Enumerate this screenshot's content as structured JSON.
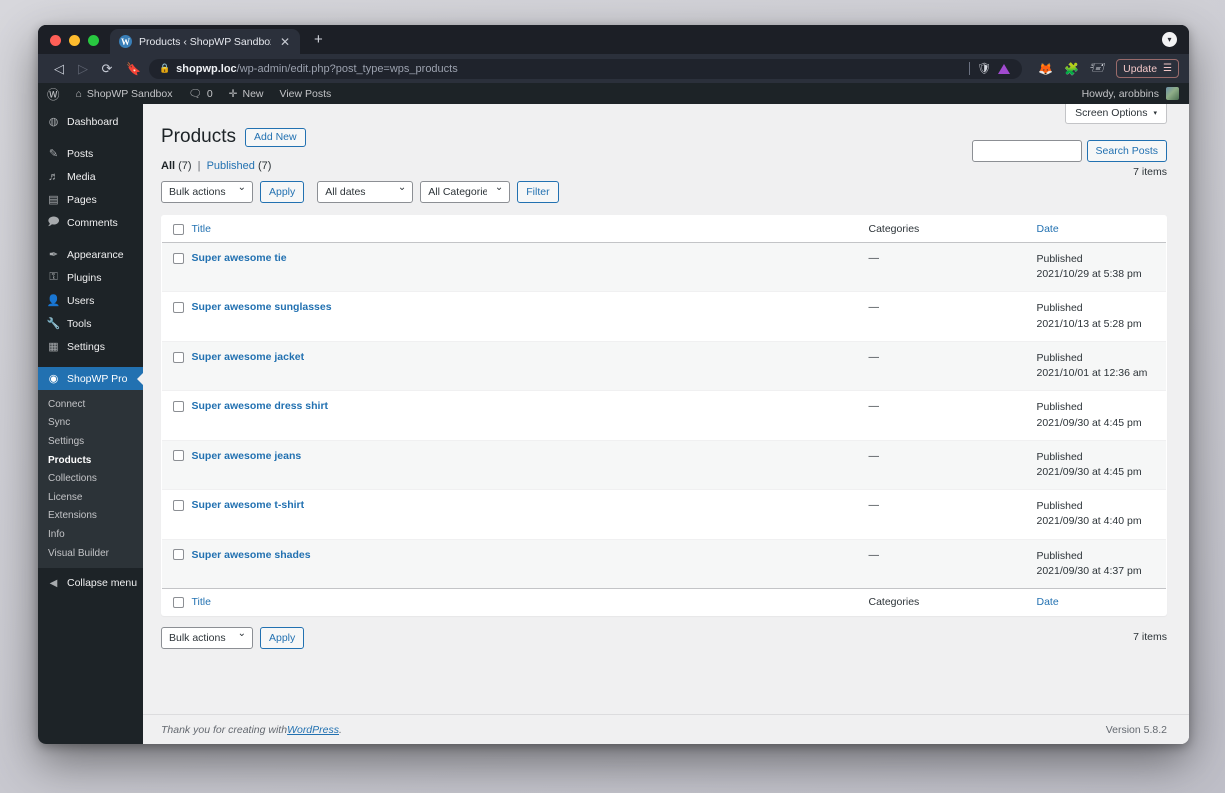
{
  "browser": {
    "tab": {
      "title": "Products ‹ ShopWP Sandbox —",
      "favicon": "wordpress-icon",
      "close": "✕"
    },
    "new_tab": "+",
    "window_menu_icon": "chevron-down-circle-icon",
    "nav": {
      "back": "◁",
      "forward": "▷",
      "reload": "⟳",
      "bookmark": "bookmark-icon"
    },
    "url": {
      "lock": "🔒",
      "host": "shopwp.loc",
      "path": "/wp-admin/edit.php?post_type=wps_products"
    },
    "omnibox_icons": [
      "brave-shield-icon",
      "triangle-extension-icon"
    ],
    "toolbar_icons": [
      "fox-extension-icon",
      "puzzle-extension-icon",
      "profile-card-icon"
    ],
    "update_button": {
      "label": "Update",
      "menu_icon": "hamburger-icon",
      "color": "#f3c7c7"
    }
  },
  "adminbar": {
    "logo": "wordpress-logo-icon",
    "site_name": "ShopWP Sandbox",
    "site_icon": "home-icon",
    "comments_icon": "comment-bubble-icon",
    "comments_count": "0",
    "new_icon": "plus-icon",
    "new_label": "New",
    "view_posts": "View Posts",
    "howdy": "Howdy, arobbins",
    "avatar": "user-avatar"
  },
  "sidebar": {
    "items": [
      {
        "label": "Dashboard",
        "icon": "dashboard-icon",
        "glyph": "◍"
      },
      {
        "label": "Posts",
        "icon": "pin-icon",
        "glyph": "✎"
      },
      {
        "label": "Media",
        "icon": "media-icon",
        "glyph": "♫"
      },
      {
        "label": "Pages",
        "icon": "pages-icon",
        "glyph": "▤"
      },
      {
        "label": "Comments",
        "icon": "comment-icon",
        "glyph": "▭"
      },
      {
        "label": "Appearance",
        "icon": "brush-icon",
        "glyph": "✒"
      },
      {
        "label": "Plugins",
        "icon": "plug-icon",
        "glyph": "⚿"
      },
      {
        "label": "Users",
        "icon": "users-icon",
        "glyph": "👤"
      },
      {
        "label": "Tools",
        "icon": "wrench-icon",
        "glyph": "🔧"
      },
      {
        "label": "Settings",
        "icon": "settings-icon",
        "glyph": "⚙"
      }
    ],
    "current_menu": {
      "label": "ShopWP Pro",
      "icon": "shopwp-icon",
      "glyph": "◉",
      "accent": "#2271b1"
    },
    "submenu": [
      {
        "label": "Connect",
        "current": false
      },
      {
        "label": "Sync",
        "current": false
      },
      {
        "label": "Settings",
        "current": false
      },
      {
        "label": "Products",
        "current": true
      },
      {
        "label": "Collections",
        "current": false
      },
      {
        "label": "License",
        "current": false
      },
      {
        "label": "Extensions",
        "current": false
      },
      {
        "label": "Info",
        "current": false
      },
      {
        "label": "Visual Builder",
        "current": false
      }
    ],
    "collapse": {
      "label": "Collapse menu",
      "icon": "collapse-arrow-icon",
      "glyph": "◀"
    }
  },
  "screen_options": {
    "label": "Screen Options",
    "caret": "▾"
  },
  "header": {
    "title": "Products",
    "add_new": "Add New"
  },
  "views": {
    "all_label": "All",
    "all_count": "(7)",
    "separator": "|",
    "published_label": "Published",
    "published_count": "(7)"
  },
  "toolbar_top": {
    "bulk_actions": "Bulk actions",
    "apply": "Apply",
    "all_dates": "All dates",
    "all_categories": "All Categories",
    "filter": "Filter"
  },
  "search": {
    "value": "",
    "placeholder": "",
    "button": "Search Posts"
  },
  "counts": {
    "items_top": "7 items",
    "items_bottom": "7 items"
  },
  "table": {
    "columns": {
      "title": "Title",
      "categories": "Categories",
      "date": "Date"
    },
    "rows": [
      {
        "title": "Super awesome tie",
        "categories": "—",
        "status": "Published",
        "date": "2021/10/29 at 5:38 pm"
      },
      {
        "title": "Super awesome sunglasses",
        "categories": "—",
        "status": "Published",
        "date": "2021/10/13 at 5:28 pm"
      },
      {
        "title": "Super awesome jacket",
        "categories": "—",
        "status": "Published",
        "date": "2021/10/01 at 12:36 am"
      },
      {
        "title": "Super awesome dress shirt",
        "categories": "—",
        "status": "Published",
        "date": "2021/09/30 at 4:45 pm"
      },
      {
        "title": "Super awesome jeans",
        "categories": "—",
        "status": "Published",
        "date": "2021/09/30 at 4:45 pm"
      },
      {
        "title": "Super awesome t-shirt",
        "categories": "—",
        "status": "Published",
        "date": "2021/09/30 at 4:40 pm"
      },
      {
        "title": "Super awesome shades",
        "categories": "—",
        "status": "Published",
        "date": "2021/09/30 at 4:37 pm"
      }
    ]
  },
  "toolbar_bottom": {
    "bulk_actions": "Bulk actions",
    "apply": "Apply"
  },
  "footer": {
    "thanks_prefix": "Thank you for creating with ",
    "wordpress_link": "WordPress",
    "thanks_suffix": ".",
    "version": "Version 5.8.2"
  }
}
